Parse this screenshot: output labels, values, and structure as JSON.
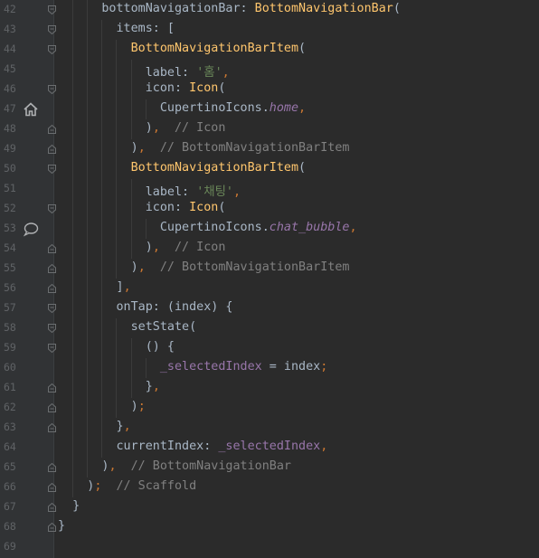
{
  "editor": {
    "colors": {
      "background": "#2b2b2b",
      "gutter": "#313335",
      "line_number": "#606366",
      "plain": "#a9b7c6",
      "type": "#ffc66d",
      "string": "#6a8759",
      "comment": "#808080",
      "punctuation": "#cc7832",
      "field": "#9876aa"
    },
    "lines": [
      {
        "num": "42",
        "fold": "open",
        "tokens": [
          {
            "c": "plain",
            "t": "      bottomNavigationBar: "
          },
          {
            "c": "type",
            "t": "BottomNavigationBar"
          },
          {
            "c": "plain",
            "t": "("
          }
        ]
      },
      {
        "num": "43",
        "fold": "open",
        "tokens": [
          {
            "c": "plain",
            "t": "        items: ["
          }
        ]
      },
      {
        "num": "44",
        "fold": "open",
        "tokens": [
          {
            "c": "type",
            "t": "          BottomNavigationBarItem"
          },
          {
            "c": "plain",
            "t": "("
          }
        ]
      },
      {
        "num": "45",
        "fold": "",
        "tokens": [
          {
            "c": "plain",
            "t": "            label: "
          },
          {
            "c": "str",
            "t": "'홈'"
          },
          {
            "c": "punc",
            "t": ","
          }
        ]
      },
      {
        "num": "46",
        "fold": "open",
        "tokens": [
          {
            "c": "plain",
            "t": "            icon: "
          },
          {
            "c": "type",
            "t": "Icon"
          },
          {
            "c": "plain",
            "t": "("
          }
        ]
      },
      {
        "num": "47",
        "fold": "",
        "icon": "home-icon",
        "tokens": [
          {
            "c": "plain",
            "t": "              CupertinoIcons."
          },
          {
            "c": "field",
            "t": "home"
          },
          {
            "c": "punc",
            "t": ","
          }
        ]
      },
      {
        "num": "48",
        "fold": "close",
        "tokens": [
          {
            "c": "plain",
            "t": "            )"
          },
          {
            "c": "punc",
            "t": ","
          },
          {
            "c": "plain",
            "t": "  "
          },
          {
            "c": "cmt",
            "t": "// Icon"
          }
        ]
      },
      {
        "num": "49",
        "fold": "close",
        "tokens": [
          {
            "c": "plain",
            "t": "          )"
          },
          {
            "c": "punc",
            "t": ","
          },
          {
            "c": "plain",
            "t": "  "
          },
          {
            "c": "cmt",
            "t": "// BottomNavigationBarItem"
          }
        ]
      },
      {
        "num": "50",
        "fold": "open",
        "tokens": [
          {
            "c": "type",
            "t": "          BottomNavigationBarItem"
          },
          {
            "c": "plain",
            "t": "("
          }
        ]
      },
      {
        "num": "51",
        "fold": "",
        "tokens": [
          {
            "c": "plain",
            "t": "            label: "
          },
          {
            "c": "str",
            "t": "'채팅'"
          },
          {
            "c": "punc",
            "t": ","
          }
        ]
      },
      {
        "num": "52",
        "fold": "open",
        "tokens": [
          {
            "c": "plain",
            "t": "            icon: "
          },
          {
            "c": "type",
            "t": "Icon"
          },
          {
            "c": "plain",
            "t": "("
          }
        ]
      },
      {
        "num": "53",
        "fold": "",
        "icon": "chat-bubble-icon",
        "tokens": [
          {
            "c": "plain",
            "t": "              CupertinoIcons."
          },
          {
            "c": "field",
            "t": "chat_bubble"
          },
          {
            "c": "punc",
            "t": ","
          }
        ]
      },
      {
        "num": "54",
        "fold": "close",
        "tokens": [
          {
            "c": "plain",
            "t": "            )"
          },
          {
            "c": "punc",
            "t": ","
          },
          {
            "c": "plain",
            "t": "  "
          },
          {
            "c": "cmt",
            "t": "// Icon"
          }
        ]
      },
      {
        "num": "55",
        "fold": "close",
        "tokens": [
          {
            "c": "plain",
            "t": "          )"
          },
          {
            "c": "punc",
            "t": ","
          },
          {
            "c": "plain",
            "t": "  "
          },
          {
            "c": "cmt",
            "t": "// BottomNavigationBarItem"
          }
        ]
      },
      {
        "num": "56",
        "fold": "close",
        "tokens": [
          {
            "c": "plain",
            "t": "        ]"
          },
          {
            "c": "punc",
            "t": ","
          }
        ]
      },
      {
        "num": "57",
        "fold": "open",
        "tokens": [
          {
            "c": "plain",
            "t": "        onTap: (index) {"
          }
        ]
      },
      {
        "num": "58",
        "fold": "open",
        "tokens": [
          {
            "c": "plain",
            "t": "          setState("
          }
        ]
      },
      {
        "num": "59",
        "fold": "open",
        "tokens": [
          {
            "c": "plain",
            "t": "            () {"
          }
        ]
      },
      {
        "num": "60",
        "fold": "",
        "tokens": [
          {
            "c": "plain",
            "t": "              "
          },
          {
            "c": "var",
            "t": "_selectedIndex"
          },
          {
            "c": "plain",
            "t": " = index"
          },
          {
            "c": "punc",
            "t": ";"
          }
        ]
      },
      {
        "num": "61",
        "fold": "close",
        "tokens": [
          {
            "c": "plain",
            "t": "            }"
          },
          {
            "c": "punc",
            "t": ","
          }
        ]
      },
      {
        "num": "62",
        "fold": "close",
        "tokens": [
          {
            "c": "plain",
            "t": "          )"
          },
          {
            "c": "punc",
            "t": ";"
          }
        ]
      },
      {
        "num": "63",
        "fold": "close",
        "tokens": [
          {
            "c": "plain",
            "t": "        }"
          },
          {
            "c": "punc",
            "t": ","
          }
        ]
      },
      {
        "num": "64",
        "fold": "",
        "tokens": [
          {
            "c": "plain",
            "t": "        currentIndex: "
          },
          {
            "c": "var",
            "t": "_selectedIndex"
          },
          {
            "c": "punc",
            "t": ","
          }
        ]
      },
      {
        "num": "65",
        "fold": "close",
        "tokens": [
          {
            "c": "plain",
            "t": "      )"
          },
          {
            "c": "punc",
            "t": ","
          },
          {
            "c": "plain",
            "t": "  "
          },
          {
            "c": "cmt",
            "t": "// BottomNavigationBar"
          }
        ]
      },
      {
        "num": "66",
        "fold": "close",
        "tokens": [
          {
            "c": "plain",
            "t": "    )"
          },
          {
            "c": "punc",
            "t": ";"
          },
          {
            "c": "plain",
            "t": "  "
          },
          {
            "c": "cmt",
            "t": "// Scaffold"
          }
        ]
      },
      {
        "num": "67",
        "fold": "close",
        "tokens": [
          {
            "c": "plain",
            "t": "  }"
          }
        ]
      },
      {
        "num": "68",
        "fold": "close",
        "tokens": [
          {
            "c": "plain",
            "t": "}"
          }
        ]
      },
      {
        "num": "69",
        "fold": "",
        "tokens": []
      }
    ]
  }
}
